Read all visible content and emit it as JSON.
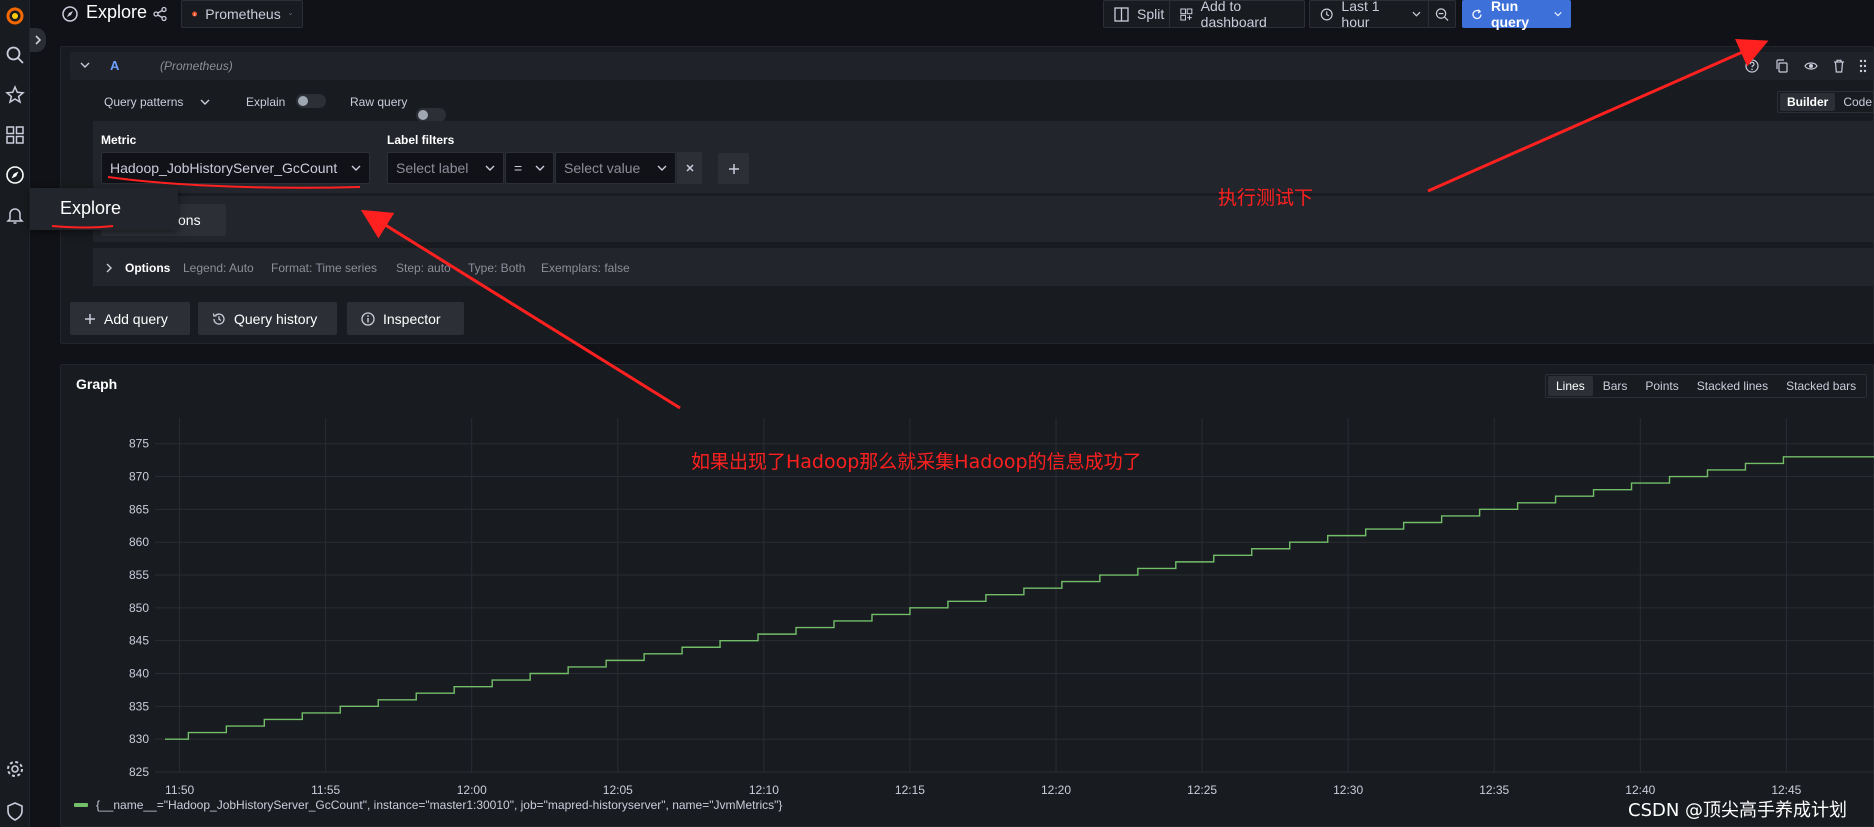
{
  "colors": {
    "accent": "#3d71d9",
    "series": "#73bf69",
    "annotation": "#ff2020",
    "prometheus": "#e6522c"
  },
  "topnav": {
    "page_title": "Explore",
    "datasource": "Prometheus",
    "split": "Split",
    "add_to_dashboard": "Add to dashboard",
    "time_range": "Last 1 hour",
    "run_query": "Run query"
  },
  "sidebar": {
    "tooltip": "Explore"
  },
  "query": {
    "ref_id": "A",
    "datasource_label": "(Prometheus)",
    "query_patterns": "Query patterns",
    "explain": "Explain",
    "raw_query": "Raw query",
    "mode_builder": "Builder",
    "mode_code": "Code",
    "metric_label": "Metric",
    "metric_value": "Hadoop_JobHistoryServer_GcCount",
    "label_filters_label": "Label filters",
    "select_label": "Select label",
    "operator": "=",
    "select_value": "Select value",
    "operations_partial": "tions",
    "options_label": "Options",
    "opt_legend": "Legend: Auto",
    "opt_format": "Format: Time series",
    "opt_step": "Step: auto",
    "opt_type": "Type: Both",
    "opt_exemplars": "Exemplars: false"
  },
  "actions": {
    "add_query": "Add query",
    "query_history": "Query history",
    "inspector": "Inspector"
  },
  "graph": {
    "title": "Graph",
    "viz_options": [
      "Lines",
      "Bars",
      "Points",
      "Stacked lines",
      "Stacked bars"
    ],
    "active_viz": "Lines",
    "legend": "{__name__=\"Hadoop_JobHistoryServer_GcCount\", instance=\"master1:30010\", job=\"mapred-historyserver\", name=\"JvmMetrics\"}"
  },
  "chart_data": {
    "type": "line",
    "title": "",
    "xlabel": "",
    "ylabel": "",
    "x_ticks": [
      "11:50",
      "11:55",
      "12:00",
      "12:05",
      "12:10",
      "12:15",
      "12:20",
      "12:25",
      "12:30",
      "12:35",
      "12:40",
      "12:45"
    ],
    "y_ticks": [
      825,
      830,
      835,
      840,
      845,
      850,
      855,
      860,
      865,
      870,
      875
    ],
    "xlim_minutes_after_1150": [
      -0.5,
      58
    ],
    "ylim": [
      825,
      878
    ],
    "grid": true,
    "series": [
      {
        "name": "{__name__=\"Hadoop_JobHistoryServer_GcCount\", instance=\"master1:30010\", job=\"mapred-historyserver\", name=\"JvmMetrics\"}",
        "step": true,
        "x_minutes_after_1150": [
          -0.5,
          0.3,
          1.6,
          2.9,
          4.2,
          5.5,
          6.8,
          8.1,
          9.4,
          10.7,
          12.0,
          13.3,
          14.6,
          15.9,
          17.2,
          18.5,
          19.8,
          21.1,
          22.4,
          23.7,
          25.0,
          26.3,
          27.6,
          28.9,
          30.2,
          31.5,
          32.8,
          34.1,
          35.4,
          36.7,
          38.0,
          39.3,
          40.6,
          41.9,
          43.2,
          44.5,
          45.8,
          47.1,
          48.4,
          49.7,
          51.0,
          52.3,
          53.6,
          54.9,
          56.2,
          57.5
        ],
        "values": [
          830,
          831,
          832,
          833,
          834,
          835,
          836,
          837,
          838,
          839,
          840,
          841,
          842,
          843,
          844,
          845,
          846,
          847,
          848,
          849,
          850,
          851,
          852,
          853,
          854,
          855,
          856,
          857,
          858,
          859,
          860,
          861,
          862,
          863,
          864,
          865,
          866,
          867,
          868,
          869,
          870,
          871,
          872,
          873,
          873,
          873
        ]
      }
    ]
  },
  "annotations": {
    "run_test": "执行测试下",
    "success_note": "如果出现了Hadoop那么就采集Hadoop的信息成功了",
    "watermark": "CSDN @顶尖高手养成计划"
  }
}
